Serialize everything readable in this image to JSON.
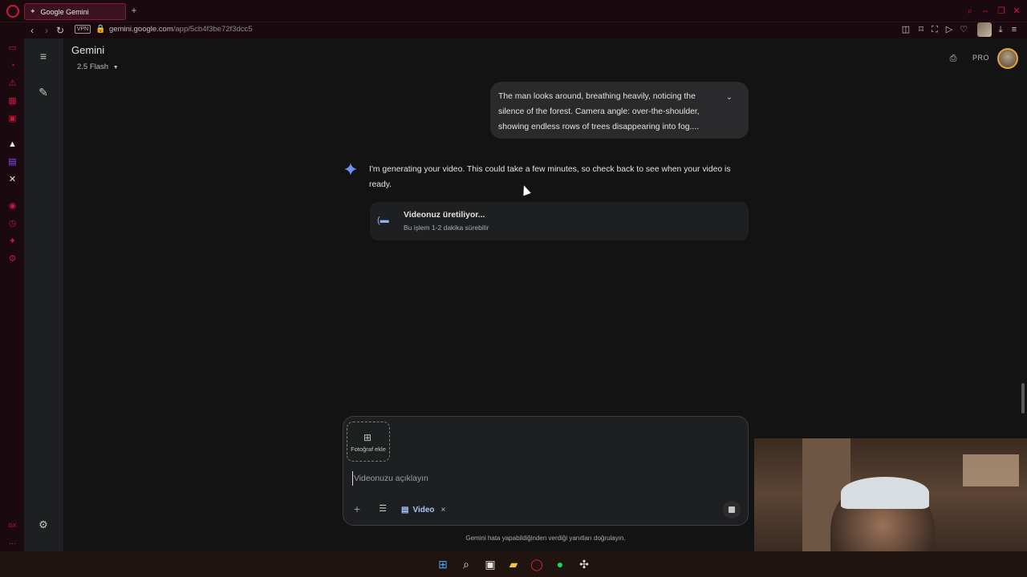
{
  "browser": {
    "tab_title": "Google Gemini",
    "new_tab_symbol": "+",
    "url_host": "gemini.google.com",
    "url_path": "/app/5cb4f3be72f3dcc5",
    "vpn_label": "VPN"
  },
  "opera_sidebar": {
    "gx_label": "GX",
    "more_label": "..."
  },
  "gemini": {
    "app_title": "Gemini",
    "model_label": "2.5 Flash",
    "pro_badge": "PRO"
  },
  "conversation": {
    "user_message": "The man looks around, breathing heavily, noticing the silence of the forest. Camera angle: over-the-shoulder, showing endless rows of trees disappearing into fog....",
    "response_text": "I'm generating your video. This could take a few minutes, so check back to see when your video is ready.",
    "video_card": {
      "title": "Videonuz üretiliyor...",
      "subtitle": "Bu işlem 1-2 dakika sürebilir"
    }
  },
  "composer": {
    "add_photo_label": "Fotoğraf ekle",
    "placeholder": "Videonuzu açıklayın",
    "tool_chip_label": "Video",
    "chip_close": "×"
  },
  "disclaimer": "Gemini hata yapabildiğinden verdiği yanıtları doğrulayın.",
  "colors": {
    "accent_opera": "#d3173b",
    "gemini_blue": "#8ab4f8",
    "background": "#131314"
  }
}
